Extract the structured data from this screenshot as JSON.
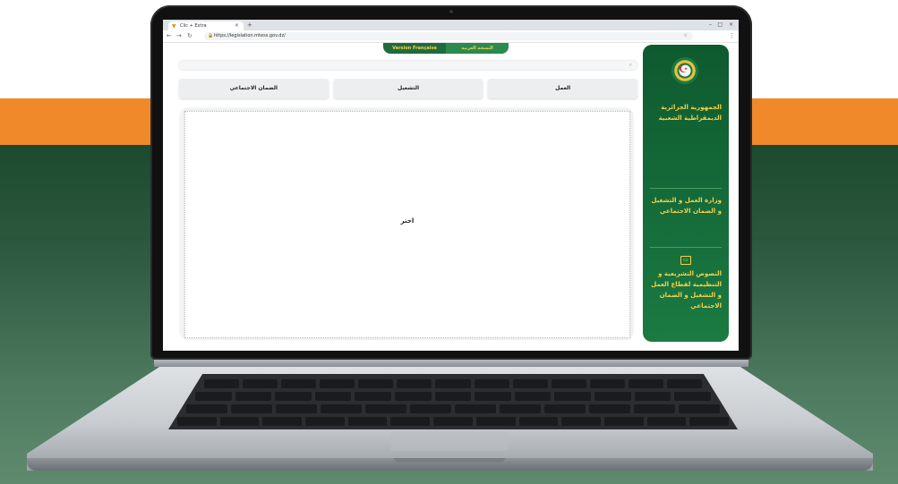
{
  "browser": {
    "tab_title": "Clic + Extra",
    "url": "https://legislation.mtess.gov.dz/"
  },
  "page": {
    "lang_french": "Version Française",
    "lang_arabic": "النسخة العربية",
    "categories": [
      "العمل",
      "التشغيل",
      "الضمان الاجتماعي"
    ],
    "choose": "اختر",
    "sidebar": {
      "republic": "الجمهورية الجزائرية الديمقراطية الشعبية",
      "ministry": "وزارة العمل و التشغيل و الضمان الاجتماعي",
      "texts": "النصوص التشريعية و التنظيمية لقطاع العمل و التشغيل و الضمان الاجتماعي"
    }
  },
  "colors": {
    "orange_band": "#f0892a",
    "dark_green": "#1c4a2e",
    "sidebar_green": "#0e5a2f",
    "gold_text": "#f6d24a"
  },
  "icons": [
    "favicon-icon",
    "lock-icon",
    "search-icon",
    "emblem-icon",
    "book-icon"
  ]
}
